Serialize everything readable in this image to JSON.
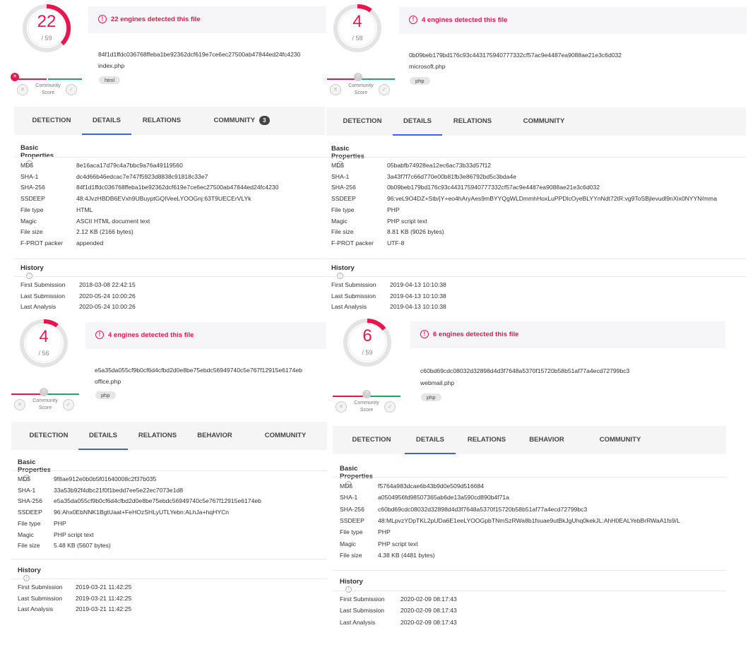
{
  "panels": [
    {
      "score": "22",
      "total": "/ 59",
      "alert": "22 engines detected this file",
      "hash": "84f1d1ffdc036768ffeba1be92362dcf619e7ce6ec27500ab47844ed24fc4230",
      "filename": "index.php",
      "tag": "html",
      "community_label_1": "Community",
      "community_label_2": "Score",
      "tabs": [
        "DETECTION",
        "DETAILS",
        "RELATIONS",
        "COMMUNITY"
      ],
      "community_badge": "3",
      "basic_title": "Basic Properties",
      "basic": [
        {
          "k": "MD5",
          "v": "8e16aca17d79c4a7bbc9a76a49119560"
        },
        {
          "k": "SHA-1",
          "v": "dc4d66b46edcac7e747f5923d8838c91818c33e7"
        },
        {
          "k": "SHA-256",
          "v": "84f1d1ffdc036768ffeba1be92362dcf619e7ce6ec27500ab47844ed24fc4230"
        },
        {
          "k": "SSDEEP",
          "v": "48:4JvzHBDB6EVxh9UBuyptGQIVeeLYOOGnj:63T9UECErVLYk"
        },
        {
          "k": "File type",
          "v": "HTML"
        },
        {
          "k": "Magic",
          "v": "ASCII HTML document text"
        },
        {
          "k": "File size",
          "v": "2.12 KB (2166 bytes)"
        },
        {
          "k": "F-PROT packer",
          "v": "appended"
        }
      ],
      "history_title": "History",
      "history": [
        {
          "k": "First Submission",
          "v": "2018-03-08 22:42:15"
        },
        {
          "k": "Last Submission",
          "v": "2020-05-24 10:00:26"
        },
        {
          "k": "Last Analysis",
          "v": "2020-05-24 10:00:26"
        }
      ]
    },
    {
      "score": "4",
      "total": "/ 58",
      "alert": "4 engines detected this file",
      "hash": "0b09beb179bd176c93c443175940777332cf57ac9e4487ea9088ae21e3c6d032",
      "filename": "microsoft.php",
      "tag": "php",
      "community_label_1": "Community",
      "community_label_2": "Score",
      "tabs": [
        "DETECTION",
        "DETAILS",
        "RELATIONS",
        "COMMUNITY"
      ],
      "basic_title": "Basic Properties",
      "basic": [
        {
          "k": "MD5",
          "v": "05babfb74928ea12ec6ac73b33d57f12"
        },
        {
          "k": "SHA-1",
          "v": "3a43f7f7c66d770e00b81fb3e86792bd5c3bda4e"
        },
        {
          "k": "SHA-256",
          "v": "0b09beb179bd176c93c443175940777332cf57ac9e4487ea9088ae21e3c6d032"
        },
        {
          "k": "SSDEEP",
          "v": "96:veL9O4DZ+Stb/jY+eo4hAryAes9mBYYQgWLDmmhHoxLuPPDlcOyeBLYYnNdt72tR:vg9ToSBjlevudl9nXix0NYYN/mma"
        },
        {
          "k": "File type",
          "v": "PHP"
        },
        {
          "k": "Magic",
          "v": "PHP script text"
        },
        {
          "k": "File size",
          "v": "8.81 KB (9026 bytes)"
        },
        {
          "k": "F-PROT packer",
          "v": "UTF-8"
        }
      ],
      "history_title": "History",
      "history": [
        {
          "k": "First Submission",
          "v": "2019-04-13 10:10:38"
        },
        {
          "k": "Last Submission",
          "v": "2019-04-13 10:10:38"
        },
        {
          "k": "Last Analysis",
          "v": "2019-04-13 10:10:38"
        }
      ]
    },
    {
      "score": "4",
      "total": "/ 56",
      "alert": "4 engines detected this file",
      "hash": "e5a35da055cf9b0cf6d4cfbd2d0e8be75ebdc56949740c5e767f12915e6174eb",
      "filename": "office.php",
      "tag": "php",
      "community_label_1": "Community",
      "community_label_2": "Score",
      "tabs": [
        "DETECTION",
        "DETAILS",
        "RELATIONS",
        "BEHAVIOR",
        "COMMUNITY"
      ],
      "basic_title": "Basic Properties",
      "basic": [
        {
          "k": "MD5",
          "v": "9f8ae912e0b0b5f01640008c2f37b035"
        },
        {
          "k": "SHA-1",
          "v": "33a53b92f4dbc21f0f1bedd7ee5e22ec7073e1d8"
        },
        {
          "k": "SHA-256",
          "v": "e5a35da055cf9b0cf6d4cfbd2d0e8be75ebdc56949740c5e767f12915e6174eb"
        },
        {
          "k": "SSDEEP",
          "v": "96:Ahx0EbNNK1BgtUaat+FeHOzSHLyUTLYebn:ALhJa+hqHYCn"
        },
        {
          "k": "File type",
          "v": "PHP"
        },
        {
          "k": "Magic",
          "v": "PHP script text"
        },
        {
          "k": "File size",
          "v": "5.48 KB (5607 bytes)"
        }
      ],
      "history_title": "History",
      "history": [
        {
          "k": "First Submission",
          "v": "2019-03-21 11:42:25"
        },
        {
          "k": "Last Submission",
          "v": "2019-03-21 11:42:25"
        },
        {
          "k": "Last Analysis",
          "v": "2019-03-21 11:42:25"
        }
      ]
    },
    {
      "score": "6",
      "total": "/ 59",
      "alert": "6 engines detected this file",
      "hash": "c60bd69cdc08032d32898d4d3f7648a5370f15720b58b51af77a4ecd72799bc3",
      "filename": "webmail.php",
      "tag": "php",
      "community_label_1": "Community",
      "community_label_2": "Score",
      "tabs": [
        "DETECTION",
        "DETAILS",
        "RELATIONS",
        "BEHAVIOR",
        "COMMUNITY"
      ],
      "basic_title": "Basic Properties",
      "basic": [
        {
          "k": "MD5",
          "v": "f5764a983dcae6b43b9d0e509d516684"
        },
        {
          "k": "SHA-1",
          "v": "a0504956fd98507365ab6de13a590cd890b4f71a"
        },
        {
          "k": "SHA-256",
          "v": "c60bd69cdc08032d32898d4d3f7648a5370f15720b58b51af77a4ecd72799bc3"
        },
        {
          "k": "SSDEEP",
          "v": "48:MLpvzYDpTKL2pUDa6E1eeLYOOGpbTNmSzRWa8b1fsuae9utBkJgUhq0kekJL:AhH0EALYebBrRWaA1fs9/L"
        },
        {
          "k": "File type",
          "v": "PHP"
        },
        {
          "k": "Magic",
          "v": "PHP script text"
        },
        {
          "k": "File size",
          "v": "4.38 KB (4481 bytes)"
        }
      ],
      "history_title": "History",
      "history": [
        {
          "k": "First Submission",
          "v": "2020-02-09 08:17:43"
        },
        {
          "k": "Last Submission",
          "v": "2020-02-09 08:17:43"
        },
        {
          "k": "Last Analysis",
          "v": "2020-02-09 08:17:43"
        }
      ]
    }
  ],
  "colors": {
    "alert": "#e8164f",
    "ring_bg": "#e4e4e4",
    "tab_active": "#3b61f0",
    "positive": "#1aa96b"
  },
  "icons": {
    "alert": "alert-circle-icon",
    "info": "info-icon",
    "vote_down": "close-icon",
    "vote_up": "check-icon",
    "score_marker": "community-marker-icon"
  }
}
